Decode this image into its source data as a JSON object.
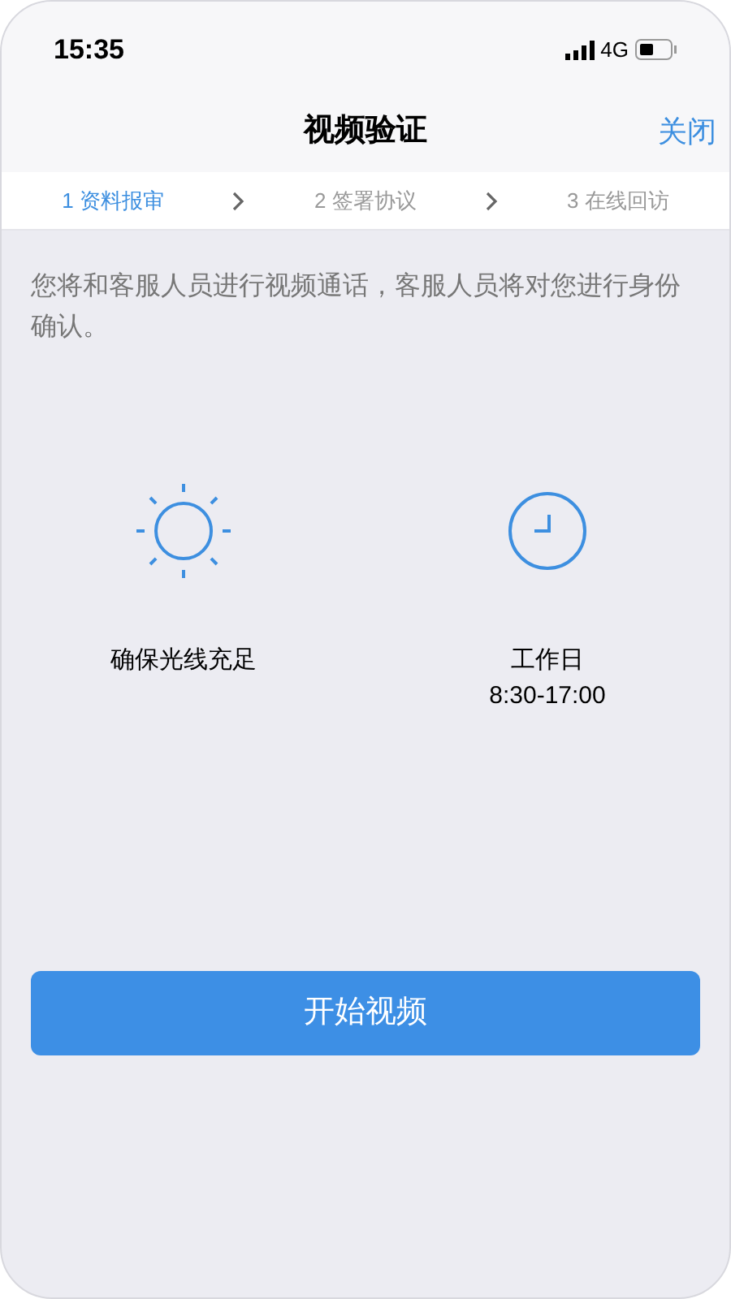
{
  "status_bar": {
    "time": "15:35",
    "network": "4G"
  },
  "nav": {
    "title": "视频验证",
    "action": "关闭"
  },
  "steps": [
    {
      "label": "1 资料报审",
      "selected": true
    },
    {
      "label": "2 签署协议",
      "selected": false
    },
    {
      "label": "3 在线回访",
      "selected": false
    }
  ],
  "intro": "您将和客服人员进行视频通话，客服人员将对您进行身份确认。",
  "tips": [
    {
      "kind": "sun",
      "lines": [
        "确保光线充足"
      ]
    },
    {
      "kind": "clock",
      "lines": [
        "工作日",
        "8:30-17:00"
      ]
    }
  ],
  "button": {
    "label": "开始视频"
  }
}
